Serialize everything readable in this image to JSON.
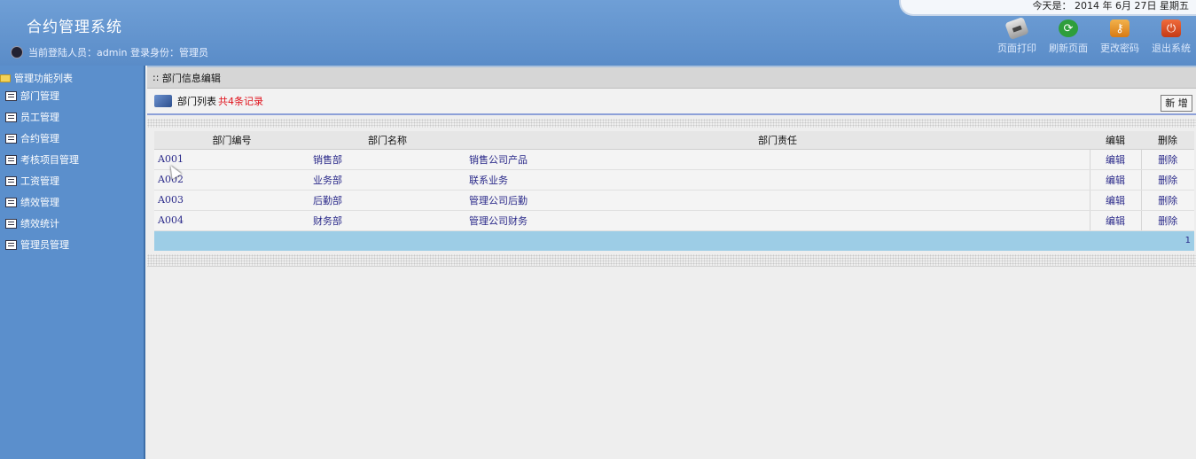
{
  "header": {
    "app_title": "合约管理系统",
    "user_line": "当前登陆人员：admin 登录身份：管理员",
    "date_text": "今天是： 2014 年 6月 27日 星期五",
    "toolbar": [
      {
        "label": "页面打印",
        "icon": "printer-icon"
      },
      {
        "label": "刷新页面",
        "icon": "refresh-icon"
      },
      {
        "label": "更改密码",
        "icon": "key-icon"
      },
      {
        "label": "退出系统",
        "icon": "power-icon"
      }
    ]
  },
  "sidebar": {
    "title": "管理功能列表",
    "items": [
      {
        "label": "部门管理"
      },
      {
        "label": "员工管理"
      },
      {
        "label": "合约管理"
      },
      {
        "label": "考核项目管理"
      },
      {
        "label": "工资管理"
      },
      {
        "label": "绩效管理"
      },
      {
        "label": "绩效统计"
      },
      {
        "label": "管理员管理"
      }
    ]
  },
  "main": {
    "breadcrumb": "部门信息编辑",
    "list_title": "部门列表",
    "list_count": "共4条记录",
    "add_label": "新 增",
    "table": {
      "headers": [
        "部门编号",
        "部门名称",
        "部门责任",
        "编辑",
        "删除"
      ],
      "rows": [
        {
          "code": "A001",
          "name": "销售部",
          "duty": "销售公司产品",
          "edit": "编辑",
          "delete": "删除"
        },
        {
          "code": "A002",
          "name": "业务部",
          "duty": "联系业务",
          "edit": "编辑",
          "delete": "删除"
        },
        {
          "code": "A003",
          "name": "后勤部",
          "duty": "管理公司后勤",
          "edit": "编辑",
          "delete": "删除"
        },
        {
          "code": "A004",
          "name": "财务部",
          "duty": "管理公司财务",
          "edit": "编辑",
          "delete": "删除"
        }
      ]
    },
    "pager": "1"
  }
}
